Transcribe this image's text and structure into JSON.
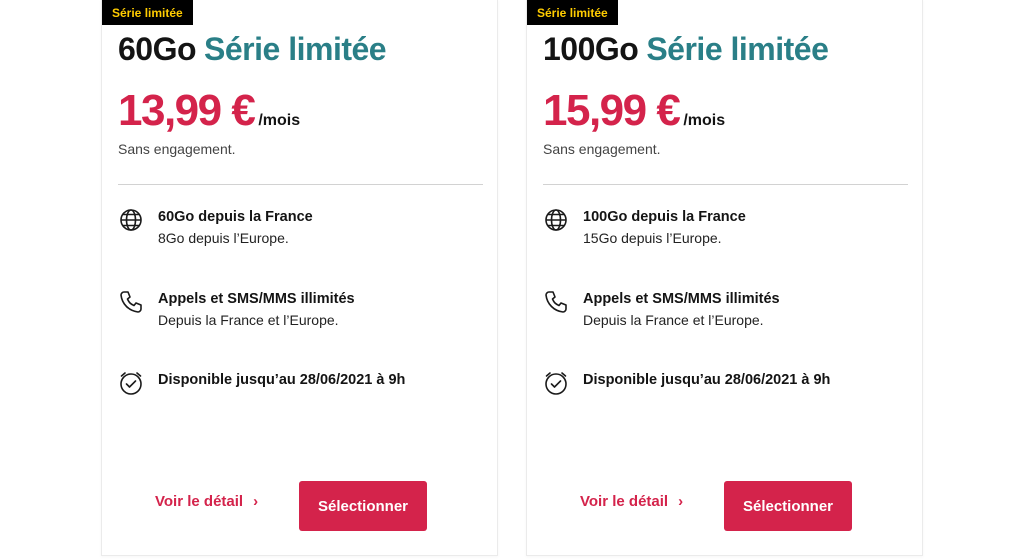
{
  "colors": {
    "accent": "#d4234b",
    "series_title": "#2a7f87",
    "badge_bg": "#000000",
    "badge_text": "#ffcc00"
  },
  "offers": [
    {
      "badge": "Série limitée",
      "title_gb": "60Go",
      "title_series": "Série limitée",
      "price": "13,99 €",
      "per": "/mois",
      "engagement": "Sans engagement.",
      "features": [
        {
          "icon": "globe-icon",
          "line1": "60Go depuis la France",
          "line2": "8Go depuis l’Europe."
        },
        {
          "icon": "phone-icon",
          "line1": "Appels et SMS/MMS illimités",
          "line2": "Depuis la France et l’Europe."
        },
        {
          "icon": "clock-icon",
          "line1": "Disponible jusqu’au 28/06/2021 à 9h",
          "line2": ""
        }
      ],
      "detail_link": "Voir le détail",
      "select_label": "Sélectionner"
    },
    {
      "badge": "Série limitée",
      "title_gb": "100Go",
      "title_series": "Série limitée",
      "price": "15,99 €",
      "per": "/mois",
      "engagement": "Sans engagement.",
      "features": [
        {
          "icon": "globe-icon",
          "line1": "100Go depuis la France",
          "line2": "15Go depuis l’Europe."
        },
        {
          "icon": "phone-icon",
          "line1": "Appels et SMS/MMS illimités",
          "line2": "Depuis la France et l’Europe."
        },
        {
          "icon": "clock-icon",
          "line1": "Disponible jusqu’au 28/06/2021 à 9h",
          "line2": ""
        }
      ],
      "detail_link": "Voir le détail",
      "select_label": "Sélectionner"
    }
  ]
}
